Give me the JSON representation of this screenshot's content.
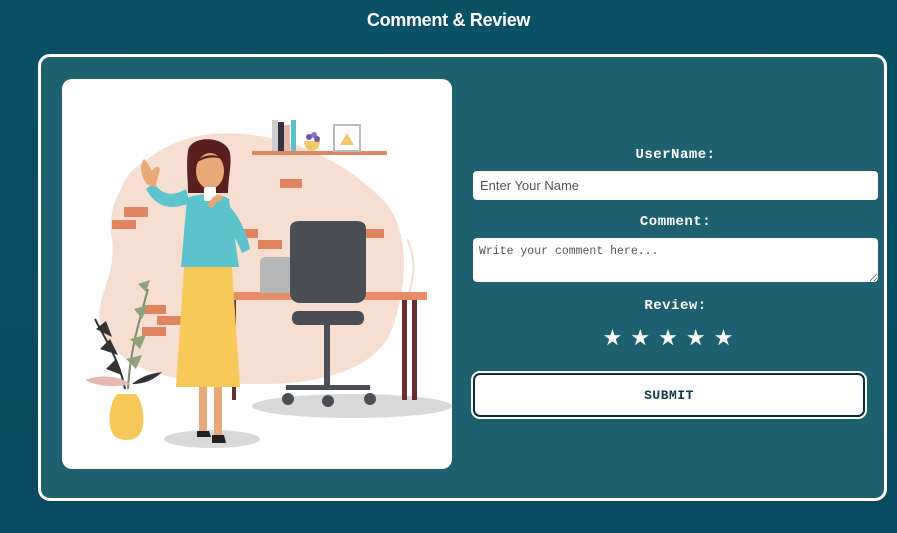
{
  "page": {
    "title": "Comment & Review"
  },
  "form": {
    "username_label": "UserName:",
    "username_placeholder": "Enter Your Name",
    "comment_label": "Comment:",
    "comment_placeholder": "Write your comment here...",
    "review_label": "Review:",
    "stars": [
      "★",
      "★",
      "★",
      "★",
      "★"
    ],
    "rating_max": 5,
    "submit_label": "SUBMIT"
  },
  "illustration": {
    "icon": "woman-at-desk-illustration"
  },
  "colors": {
    "background": "#074a5f",
    "card": "#1e6070",
    "accent_text": "#0d3a48",
    "skirt": "#f7c95a",
    "shirt": "#5dc3cc",
    "blob": "#f6ded0",
    "brick": "#e08560"
  }
}
